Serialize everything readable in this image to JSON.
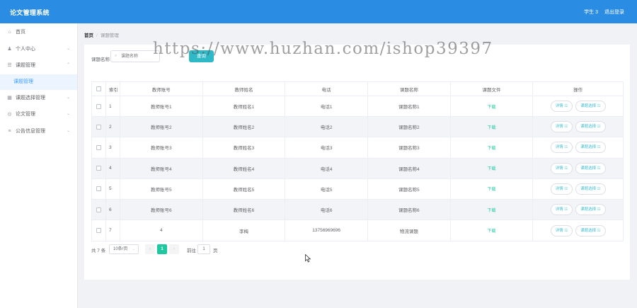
{
  "app": {
    "title": "论文管理系统",
    "user": "学生 3",
    "logout": "退出登录"
  },
  "sidebar": {
    "items": [
      {
        "icon": "home-icon",
        "glyph": "⌂",
        "label": "首页",
        "expandable": false
      },
      {
        "icon": "user-icon",
        "glyph": "♟",
        "label": "个人中心",
        "expandable": true
      },
      {
        "icon": "list-icon",
        "glyph": "☰",
        "label": "课题管理",
        "expandable": true
      },
      {
        "icon": "grid-icon",
        "glyph": "▦",
        "label": "课题选择管理",
        "expandable": true
      },
      {
        "icon": "doc-icon",
        "glyph": "◎",
        "label": "论文管理",
        "expandable": true
      },
      {
        "icon": "notice-icon",
        "glyph": "≡",
        "label": "公告信息管理",
        "expandable": true
      }
    ],
    "active_sub": "课题管理"
  },
  "breadcrumb": {
    "home": "首页",
    "sep": "/",
    "current": "课题管理"
  },
  "search": {
    "label": "课题名称",
    "placeholder": "课题名称",
    "icon": "search-icon",
    "button": "查询"
  },
  "table": {
    "columns": [
      "索引",
      "教师账号",
      "教师姓名",
      "电话",
      "课题名称",
      "课题文件",
      "操作"
    ],
    "rows": [
      {
        "index": "1",
        "teacher_no": "教师账号1",
        "teacher_name": "教师姓名1",
        "phone": "电话1",
        "title": "课题名称1",
        "file": "下载",
        "detail": "详情 ☷",
        "select": "课题选择 ☷"
      },
      {
        "index": "2",
        "teacher_no": "教师账号2",
        "teacher_name": "教师姓名2",
        "phone": "电话2",
        "title": "课题名称2",
        "file": "下载",
        "detail": "详情 ☷",
        "select": "课题选择 ☷"
      },
      {
        "index": "3",
        "teacher_no": "教师账号3",
        "teacher_name": "教师姓名3",
        "phone": "电话3",
        "title": "课题名称3",
        "file": "下载",
        "detail": "详情 ☷",
        "select": "课题选择 ☷"
      },
      {
        "index": "4",
        "teacher_no": "教师账号4",
        "teacher_name": "教师姓名4",
        "phone": "电话4",
        "title": "课题名称4",
        "file": "下载",
        "detail": "详情 ☷",
        "select": "课题选择 ☷"
      },
      {
        "index": "5",
        "teacher_no": "教师账号5",
        "teacher_name": "教师姓名5",
        "phone": "电话5",
        "title": "课题名称5",
        "file": "下载",
        "detail": "详情 ☷",
        "select": "课题选择 ☷"
      },
      {
        "index": "6",
        "teacher_no": "教师账号6",
        "teacher_name": "教师姓名6",
        "phone": "电话6",
        "title": "课题名称6",
        "file": "下载",
        "detail": "详情 ☷",
        "select": "课题选择 ☷"
      },
      {
        "index": "7",
        "teacher_no": "4",
        "teacher_name": "李梅",
        "phone": "13756969696",
        "title": "物流课题",
        "file": "下载",
        "detail": "详情 ☷",
        "select": "课题选择 ☷"
      }
    ]
  },
  "pagination": {
    "total": "共 7 条",
    "page_size": "10条/页",
    "prev": "‹",
    "current_page": "1",
    "next": "›",
    "goto": "前往",
    "goto_value": "1",
    "unit": "页"
  },
  "watermark": "https://www.huzhan.com/ishop39397",
  "colors": {
    "header": "#2a8de3",
    "accent": "#1ec9a1",
    "search_button": "#2fb8c6",
    "sidebar_active": "#409eff"
  }
}
